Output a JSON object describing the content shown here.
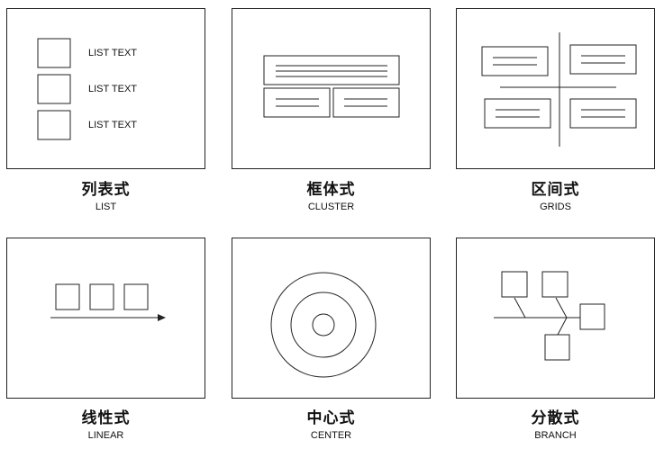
{
  "layouts": [
    {
      "id": "list",
      "title_zh": "列表式",
      "title_en": "LIST",
      "item_label": "LIST TEXT"
    },
    {
      "id": "cluster",
      "title_zh": "框体式",
      "title_en": "CLUSTER"
    },
    {
      "id": "grids",
      "title_zh": "区间式",
      "title_en": "GRIDS"
    },
    {
      "id": "linear",
      "title_zh": "线性式",
      "title_en": "LINEAR"
    },
    {
      "id": "center",
      "title_zh": "中心式",
      "title_en": "CENTER"
    },
    {
      "id": "branch",
      "title_zh": "分散式",
      "title_en": "BRANCH"
    }
  ],
  "colors": {
    "stroke": "#222222",
    "background": "#ffffff"
  }
}
